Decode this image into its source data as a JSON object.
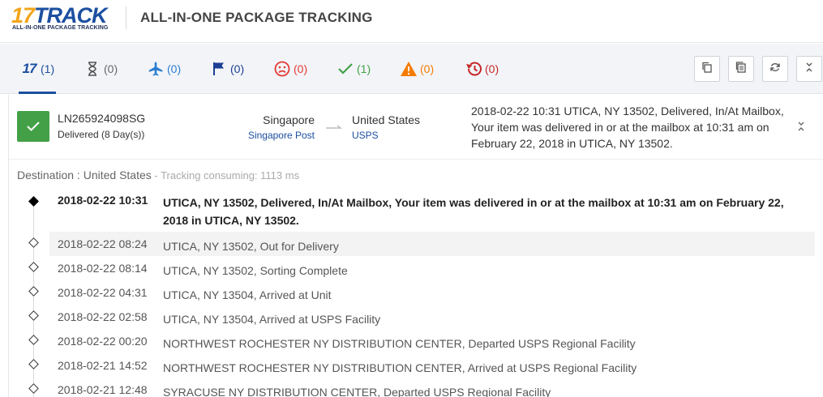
{
  "header": {
    "logo_num": "17",
    "logo_word": "TRACK",
    "logo_tagline": "ALL-IN-ONE PACKAGE TRACKING",
    "title": "ALL-IN-ONE PACKAGE TRACKING"
  },
  "tabs": [
    {
      "icon": "17track-logo-icon",
      "text": "17",
      "count": "(1)",
      "color": "#1c4fa0"
    },
    {
      "icon": "hourglass-icon",
      "count": "(0)",
      "color": "#666666"
    },
    {
      "icon": "airplane-icon",
      "count": "(0)",
      "color": "#2a7dd1"
    },
    {
      "icon": "flag-icon",
      "count": "(0)",
      "color": "#1c3f94"
    },
    {
      "icon": "sad-face-icon",
      "count": "(0)",
      "color": "#e53935"
    },
    {
      "icon": "checkmark-icon",
      "count": "(1)",
      "color": "#43a047"
    },
    {
      "icon": "warning-icon",
      "count": "(0)",
      "color": "#f57c00"
    },
    {
      "icon": "history-icon",
      "count": "(0)",
      "color": "#c62828"
    }
  ],
  "toolbar": [
    "copy-icon",
    "clipboard-icon",
    "refresh-icon",
    "collapse-all-icon"
  ],
  "package": {
    "tracking_number": "LN265924098SG",
    "status": "Delivered (8 Day(s))",
    "origin_country": "Singapore",
    "origin_carrier": "Singapore Post",
    "destination_country": "United States",
    "destination_carrier": "USPS",
    "latest_event": "2018-02-22 10:31   UTICA, NY 13502, Delivered, In/At Mailbox, Your item was delivered in or at the mailbox at 10:31 am on February 22, 2018 in UTICA, NY 13502.",
    "destination_label": "Destination : United States",
    "tracking_consume": " - Tracking consuming: 1113 ms"
  },
  "events": [
    {
      "time": "2018-02-22 10:31",
      "desc": "UTICA, NY 13502, Delivered, In/At Mailbox, Your item was delivered in or at the mailbox at 10:31 am on February 22, 2018 in UTICA, NY 13502."
    },
    {
      "time": "2018-02-22 08:24",
      "desc": "UTICA, NY 13502, Out for Delivery"
    },
    {
      "time": "2018-02-22 08:14",
      "desc": "UTICA, NY 13502, Sorting Complete"
    },
    {
      "time": "2018-02-22 04:31",
      "desc": "UTICA, NY 13504, Arrived at Unit"
    },
    {
      "time": "2018-02-22 02:58",
      "desc": "UTICA, NY 13504, Arrived at USPS Facility"
    },
    {
      "time": "2018-02-22 00:20",
      "desc": "NORTHWEST ROCHESTER NY DISTRIBUTION CENTER, Departed USPS Regional Facility"
    },
    {
      "time": "2018-02-21 14:52",
      "desc": "NORTHWEST ROCHESTER NY DISTRIBUTION CENTER, Arrived at USPS Regional Facility"
    },
    {
      "time": "2018-02-21 12:48",
      "desc": "SYRACUSE NY DISTRIBUTION CENTER, Departed USPS Regional Facility"
    }
  ]
}
